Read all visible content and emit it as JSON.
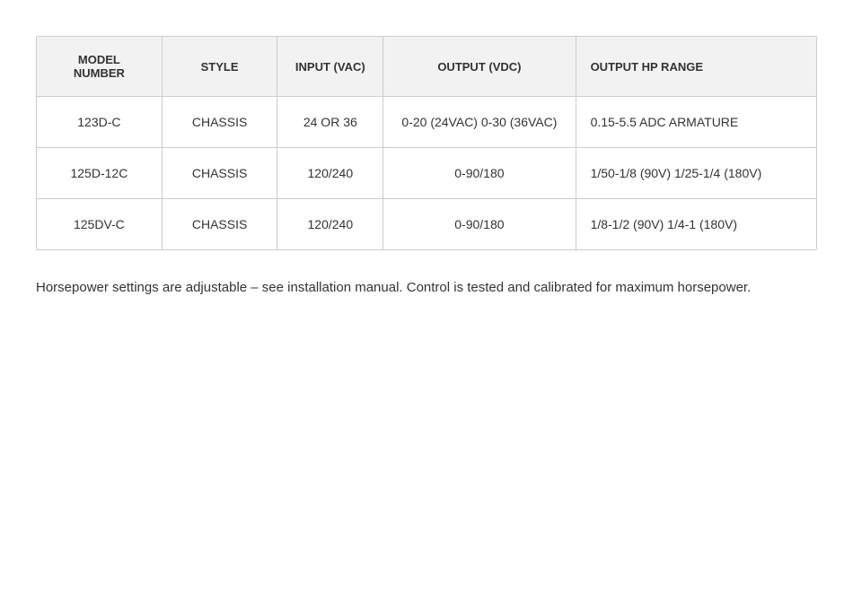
{
  "table": {
    "headers": [
      {
        "id": "model-number",
        "label": "MODEL NUMBER"
      },
      {
        "id": "style",
        "label": "STYLE"
      },
      {
        "id": "input-vac",
        "label": "INPUT (VAC)"
      },
      {
        "id": "output-vdc",
        "label": "OUTPUT (VDC)"
      },
      {
        "id": "output-hp-range",
        "label": "OUTPUT HP RANGE"
      }
    ],
    "rows": [
      {
        "model": "123D-C",
        "style": "CHASSIS",
        "input": "24 OR 36",
        "output_vdc": "0-20 (24VAC) 0-30 (36VAC)",
        "output_hp": "0.15-5.5 ADC ARMATURE"
      },
      {
        "model": "125D-12C",
        "style": "CHASSIS",
        "input": "120/240",
        "output_vdc": "0-90/180",
        "output_hp": "1/50-1/8 (90V) 1/25-1/4 (180V)"
      },
      {
        "model": "125DV-C",
        "style": "CHASSIS",
        "input": "120/240",
        "output_vdc": "0-90/180",
        "output_hp": "1/8-1/2 (90V) 1/4-1 (180V)"
      }
    ]
  },
  "note": "Horsepower settings are adjustable – see installation manual. Control is tested and calibrated for maximum horsepower."
}
